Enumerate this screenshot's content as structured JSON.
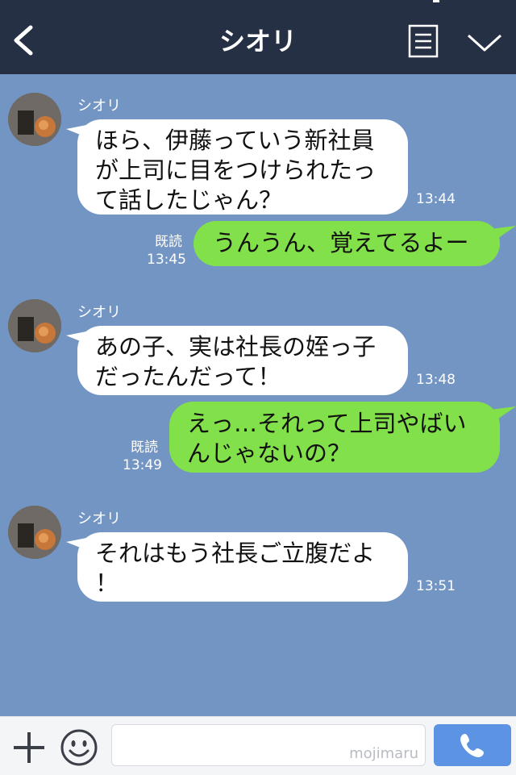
{
  "header": {
    "title": "シオリ"
  },
  "messages": [
    {
      "side": "in",
      "sender": "シオリ",
      "text": "ほら、伊藤っていう新社員\nが上司に目をつけられたっ\nて話したじゃん？",
      "time": "13:44"
    },
    {
      "side": "out",
      "read": "既読",
      "text": "うんうん、覚えてるよー",
      "time": "13:45"
    },
    {
      "side": "in",
      "sender": "シオリ",
      "text": "あの子、実は社長の姪っ子\nだったんだって！",
      "time": "13:48"
    },
    {
      "side": "out",
      "read": "既読",
      "text": "えっ…それって上司やばい\nんじゃないの？",
      "time": "13:49"
    },
    {
      "side": "in",
      "sender": "シオリ",
      "text": "それはもう社長ご立腹だよ\n！",
      "time": "13:51"
    }
  ],
  "composer": {
    "watermark": "mojimaru"
  },
  "colors": {
    "header": "#263045",
    "chat_bg": "#7395c3",
    "outgoing": "#82e04a",
    "incoming": "#ffffff",
    "send": "#5d93e3"
  },
  "icons": [
    "back-icon",
    "notes-icon",
    "chevron-down-icon",
    "plus-icon",
    "smile-icon",
    "phone-icon"
  ]
}
